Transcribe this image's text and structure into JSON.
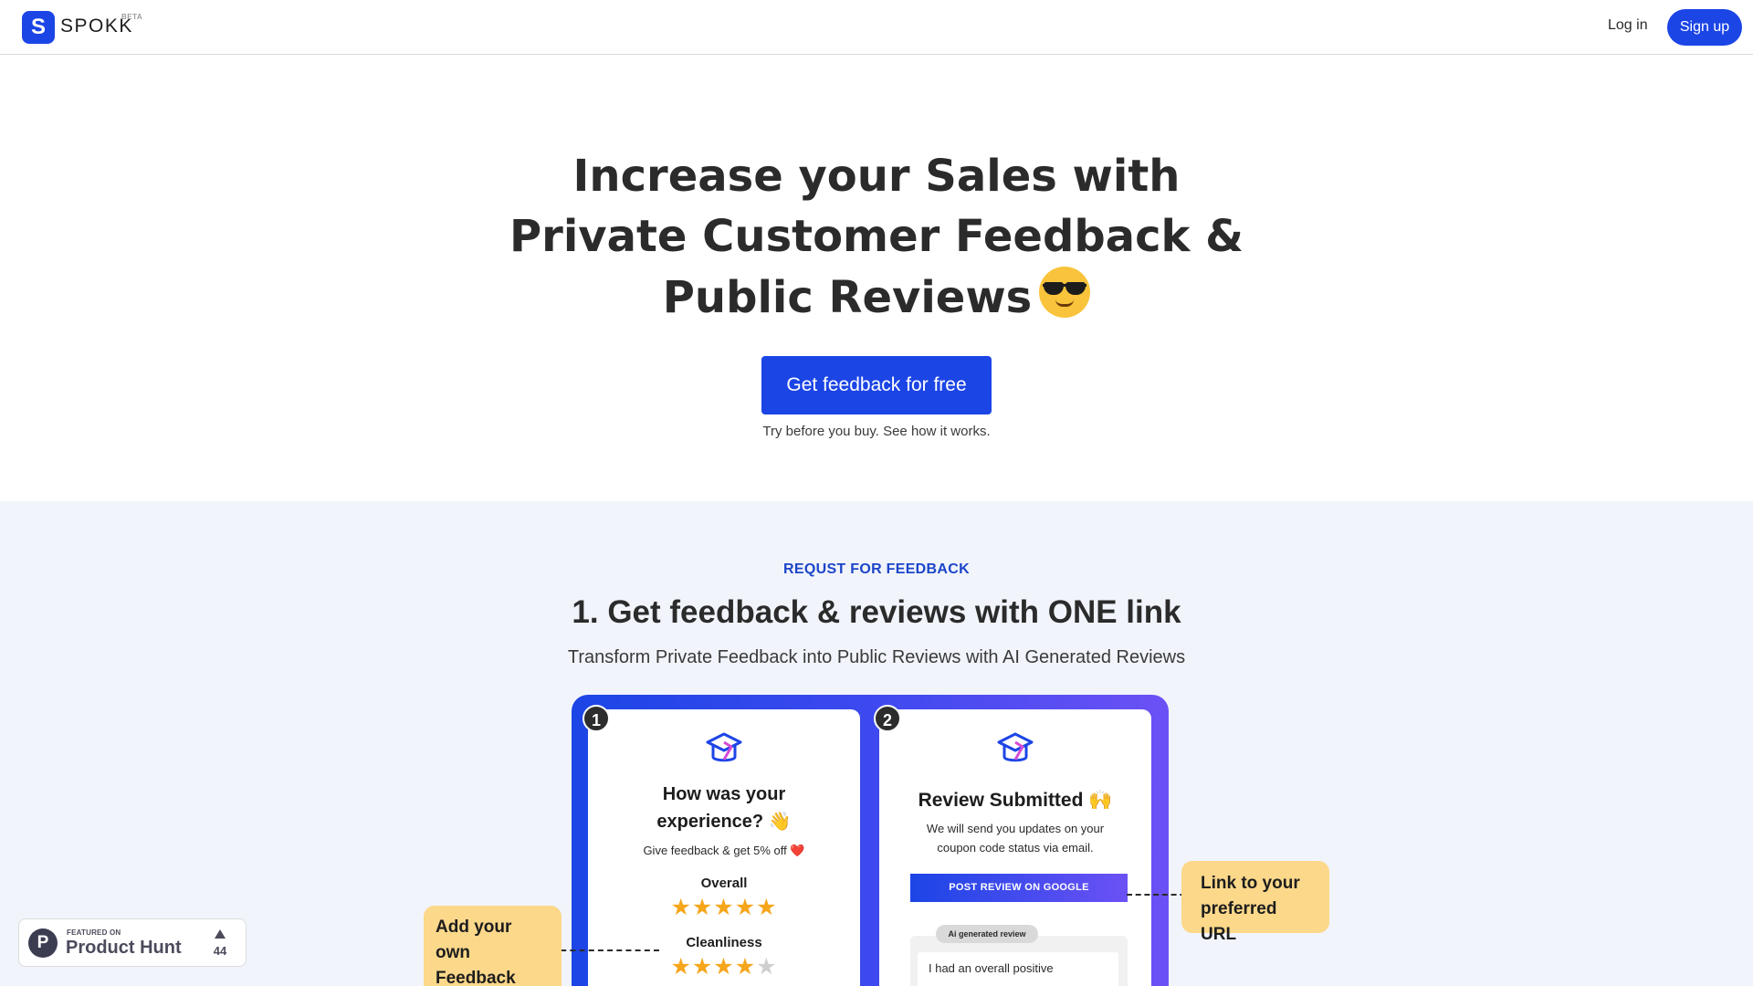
{
  "nav": {
    "logo_letter": "S",
    "brand": "SPOKK",
    "beta_badge": "BETA",
    "login_label": "Log in",
    "signup_label": "Sign up",
    "brand_color": "#1c45e6"
  },
  "hero": {
    "title_lines": [
      "Increase your Sales with",
      "Private Customer Feedback &",
      "Public Reviews"
    ],
    "title_emoji": "smiling-face-with-sunglasses",
    "cta_label": "Get feedback for free",
    "cta_subtext": "Try before you buy. See how it works."
  },
  "feature": {
    "eyebrow": "REQUST FOR FEEDBACK",
    "title": "1. Get feedback & reviews with ONE link",
    "subtitle": "Transform Private Feedback into Public Reviews with AI Generated Reviews",
    "step1": {
      "number": "1",
      "title_line1": "How was your",
      "title_line2": "experience? 👋",
      "subtitle": "Give feedback & get 5% off ❤️",
      "attributes": [
        {
          "label": "Overall",
          "rating": 5,
          "max": 5
        },
        {
          "label": "Cleanliness",
          "rating": 4,
          "max": 5
        }
      ]
    },
    "step2": {
      "number": "2",
      "title": "Review Submitted 🙌",
      "subtitle": "We will send you updates on your coupon code status via email.",
      "post_button": "POST REVIEW ON GOOGLE",
      "ai_pill": "Ai generated review",
      "ai_text": "I had an overall positive"
    },
    "callout_left": "Add your own Feedback Attributes",
    "callout_right": "Link to your preferred URL",
    "callout_color": "#fcd88a"
  },
  "product_hunt": {
    "featured_on": "FEATURED ON",
    "name": "Product Hunt",
    "upvotes": "44"
  }
}
